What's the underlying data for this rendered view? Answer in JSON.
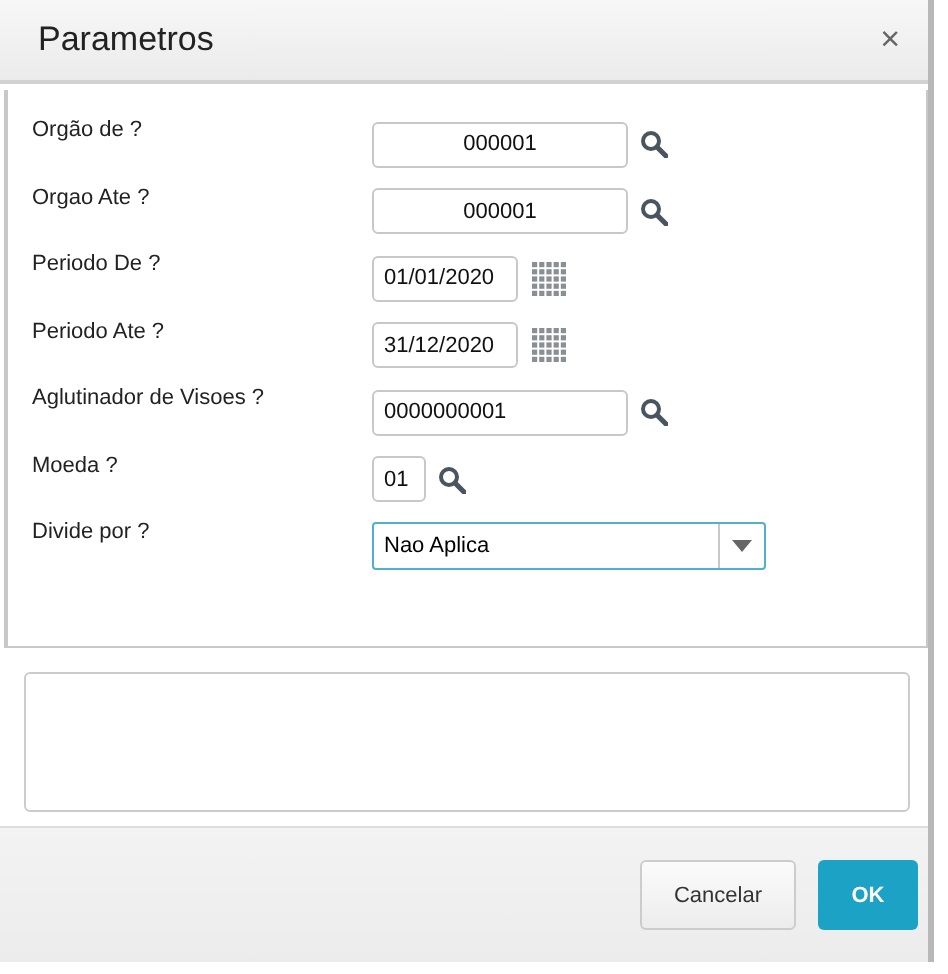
{
  "window": {
    "title": "Parametros",
    "close": "×"
  },
  "fields": [
    {
      "label": "Orgão de ?",
      "value": "000001",
      "kind": "code"
    },
    {
      "label": "Orgao Ate ?",
      "value": "000001",
      "kind": "code"
    },
    {
      "label": "Periodo De ?",
      "value": "01/01/2020",
      "kind": "date"
    },
    {
      "label": "Periodo Ate ?",
      "value": "31/12/2020",
      "kind": "date"
    },
    {
      "label": "Aglutinador de Visoes ?",
      "value": "0000000001",
      "kind": "lookup"
    },
    {
      "label": "Moeda ?",
      "value": "01",
      "kind": "short"
    },
    {
      "label": "Divide por ?",
      "value": "Nao Aplica",
      "kind": "select"
    }
  ],
  "buttons": [
    {
      "label": "Cancelar",
      "kind": "secondary"
    },
    {
      "label": "OK",
      "kind": "primary"
    }
  ]
}
